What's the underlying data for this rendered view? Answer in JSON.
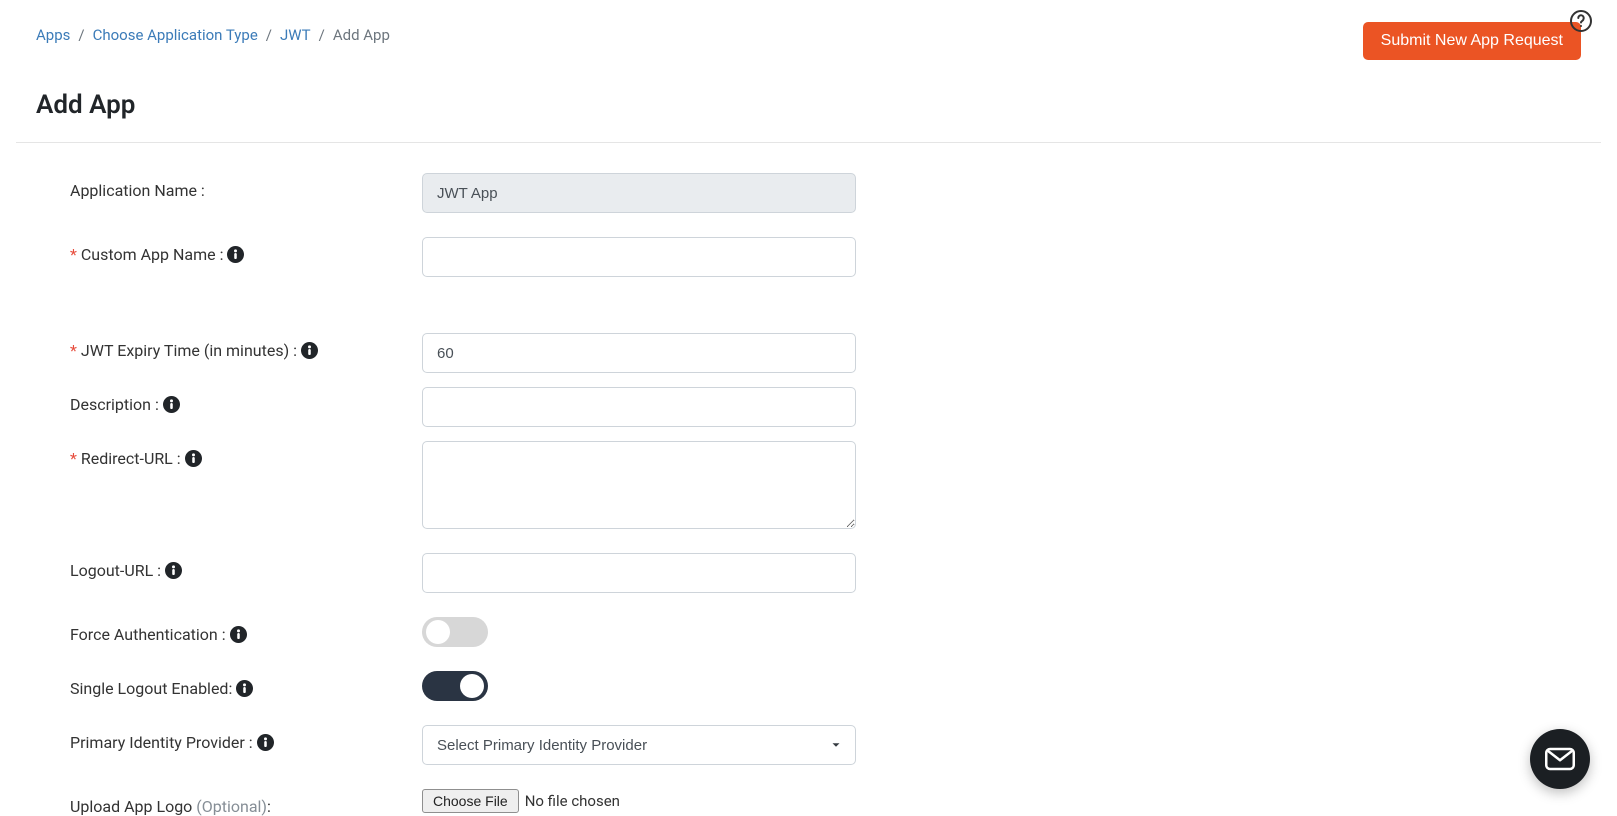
{
  "breadcrumb": {
    "items": [
      "Apps",
      "Choose Application Type",
      "JWT"
    ],
    "current": "Add App"
  },
  "header": {
    "submit_button": "Submit New App Request",
    "page_title": "Add App"
  },
  "form": {
    "application_name": {
      "label": "Application Name :",
      "value": "JWT App"
    },
    "custom_app_name": {
      "label": "Custom App Name :",
      "value": ""
    },
    "jwt_expiry": {
      "label": "JWT Expiry Time (in minutes) :",
      "value": "60"
    },
    "description": {
      "label": "Description :",
      "value": ""
    },
    "redirect_url": {
      "label": "Redirect-URL :",
      "value": ""
    },
    "logout_url": {
      "label": "Logout-URL :",
      "value": ""
    },
    "force_auth": {
      "label": "Force Authentication :",
      "on": false
    },
    "single_logout": {
      "label": "Single Logout Enabled:",
      "on": true
    },
    "primary_idp": {
      "label": "Primary Identity Provider :",
      "placeholder": "Select Primary Identity Provider"
    },
    "upload_logo": {
      "label": "Upload App Logo ",
      "optional": "(Optional)",
      "suffix": ":",
      "button": "Choose File",
      "status": "No file chosen"
    }
  }
}
